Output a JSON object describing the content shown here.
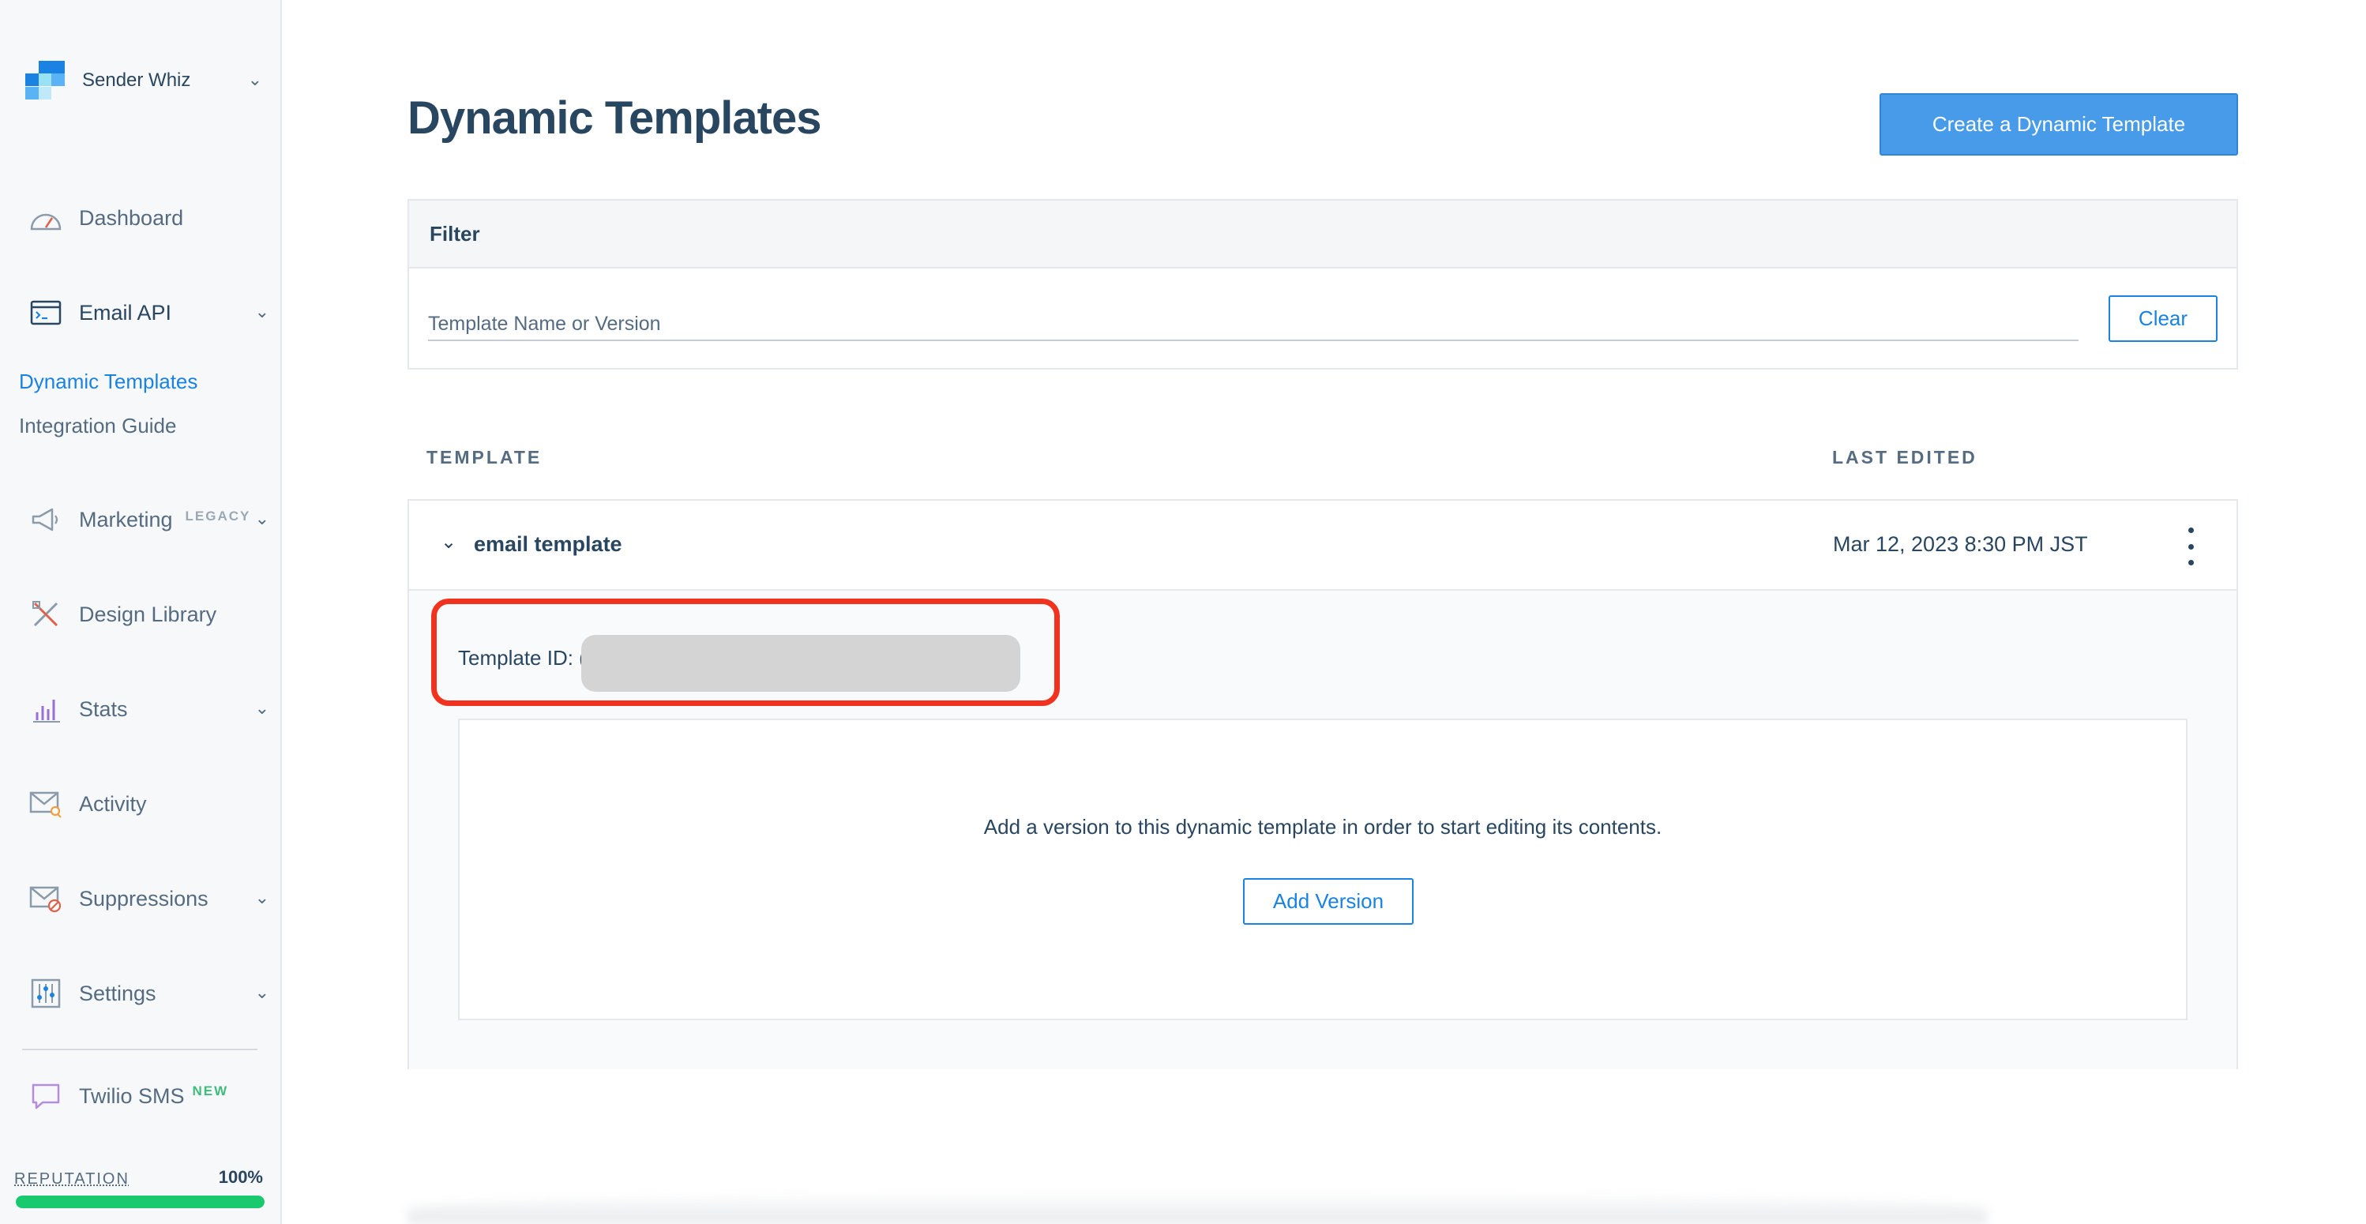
{
  "account": {
    "name": "Sender Whiz"
  },
  "nav": {
    "dashboard": "Dashboard",
    "email_api": "Email API",
    "dynamic_templates": "Dynamic Templates",
    "integration_guide": "Integration Guide",
    "marketing": "Marketing",
    "marketing_tag": "LEGACY",
    "design_library": "Design Library",
    "stats": "Stats",
    "activity": "Activity",
    "suppressions": "Suppressions",
    "settings": "Settings",
    "twilio_sms": "Twilio SMS",
    "twilio_tag": "NEW"
  },
  "reputation": {
    "label": "REPUTATION",
    "value": "100%",
    "percent": 100
  },
  "page": {
    "title": "Dynamic Templates",
    "create_button": "Create a Dynamic Template"
  },
  "filter": {
    "heading": "Filter",
    "placeholder": "Template Name or Version",
    "clear_button": "Clear"
  },
  "columns": {
    "template": "TEMPLATE",
    "last_edited": "LAST EDITED"
  },
  "template": {
    "name": "email template",
    "last_edited": "Mar 12, 2023 8:30 PM JST",
    "id_label": "Template ID: ",
    "id_visible_char": "(",
    "empty_message": "Add a version to this dynamic template in order to start editing its contents.",
    "add_version_button": "Add Version"
  },
  "colors": {
    "brand_blue": "#1a82e2",
    "primary_button": "#489be8",
    "highlight_red": "#f0321e",
    "reputation_green": "#18c96e",
    "text_dark": "#294661"
  }
}
